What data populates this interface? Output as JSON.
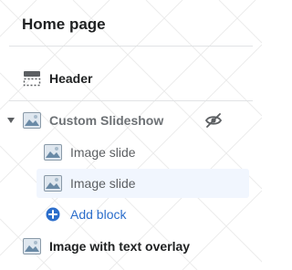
{
  "page": {
    "title": "Home page"
  },
  "sections": {
    "header": {
      "label": "Header",
      "icon": "header-section-icon"
    },
    "slideshow": {
      "label": "Custom Slideshow",
      "icon": "image-icon",
      "expanded": true,
      "hidden": true,
      "blocks": [
        {
          "label": "Image slide",
          "icon": "image-icon",
          "selected": false
        },
        {
          "label": "Image slide",
          "icon": "image-icon",
          "selected": true
        }
      ],
      "add_block_label": "Add block"
    },
    "image_overlay": {
      "label": "Image with text overlay",
      "icon": "image-icon"
    }
  },
  "colors": {
    "accent": "#2c6ecb",
    "selected_bg": "#f1f6fe",
    "divider": "#e1e3e5"
  }
}
